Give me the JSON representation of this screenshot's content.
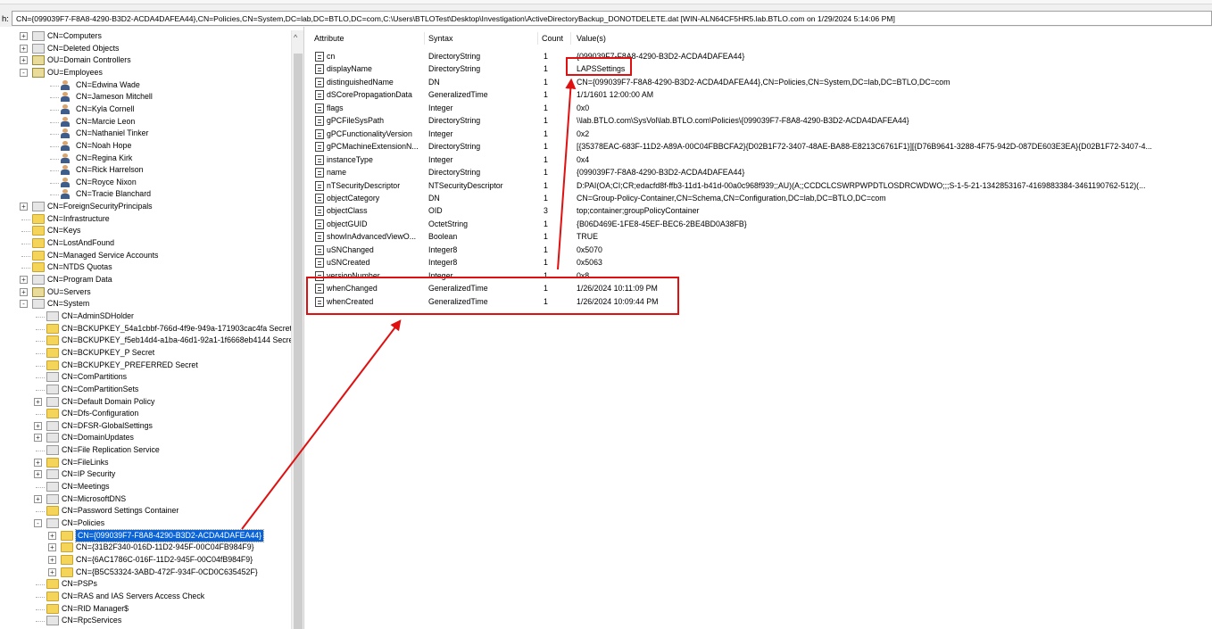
{
  "pathbar": {
    "label": "h:",
    "value": "CN={099039F7-F8A8-4290-B3D2-ACDA4DAFEA44},CN=Policies,CN=System,DC=lab,DC=BTLO,DC=com,C:\\Users\\BTLOTest\\Desktop\\Investigation\\ActiveDirectoryBackup_DONOTDELETE.dat [WIN-ALN64CF5HR5.lab.BTLO.com on 1/29/2024 5:14:06 PM]"
  },
  "tree": {
    "items": [
      {
        "label": "CN=Computers",
        "icon": "container-icon",
        "expander": "+"
      },
      {
        "label": "CN=Deleted Objects",
        "icon": "container-icon",
        "expander": "+"
      },
      {
        "label": "OU=Domain Controllers",
        "icon": "ou-icon",
        "expander": "+"
      },
      {
        "label": "OU=Employees",
        "icon": "ou-icon",
        "expander": "-"
      },
      {
        "label": "CN=Edwina Wade",
        "icon": "user-icon"
      },
      {
        "label": "CN=Jameson Mitchell",
        "icon": "user-icon"
      },
      {
        "label": "CN=Kyla Cornell",
        "icon": "user-icon"
      },
      {
        "label": "CN=Marcie Leon",
        "icon": "user-icon"
      },
      {
        "label": "CN=Nathaniel Tinker",
        "icon": "user-icon"
      },
      {
        "label": "CN=Noah Hope",
        "icon": "user-icon"
      },
      {
        "label": "CN=Regina Kirk",
        "icon": "user-icon"
      },
      {
        "label": "CN=Rick Harrelson",
        "icon": "user-icon"
      },
      {
        "label": "CN=Royce Nixon",
        "icon": "user-icon"
      },
      {
        "label": "CN=Tracie Blanchard",
        "icon": "user-icon"
      },
      {
        "label": "CN=ForeignSecurityPrincipals",
        "icon": "container-icon",
        "expander": "+"
      },
      {
        "label": "CN=Infrastructure",
        "icon": "folder-icon"
      },
      {
        "label": "CN=Keys",
        "icon": "folder-icon"
      },
      {
        "label": "CN=LostAndFound",
        "icon": "folder-icon"
      },
      {
        "label": "CN=Managed Service Accounts",
        "icon": "folder-icon"
      },
      {
        "label": "CN=NTDS Quotas",
        "icon": "folder-icon"
      },
      {
        "label": "CN=Program Data",
        "icon": "container-icon",
        "expander": "+"
      },
      {
        "label": "OU=Servers",
        "icon": "ou-icon",
        "expander": "+"
      },
      {
        "label": "CN=System",
        "icon": "container-icon",
        "expander": "-"
      },
      {
        "label": "CN=AdminSDHolder",
        "icon": "container-icon"
      },
      {
        "label": "CN=BCKUPKEY_54a1cbbf-766d-4f9e-949a-171903cac4fa Secret",
        "icon": "folder-icon"
      },
      {
        "label": "CN=BCKUPKEY_f5eb14d4-a1ba-46d1-92a1-1f6668eb4144 Secret",
        "icon": "folder-icon"
      },
      {
        "label": "CN=BCKUPKEY_P Secret",
        "icon": "folder-icon"
      },
      {
        "label": "CN=BCKUPKEY_PREFERRED Secret",
        "icon": "folder-icon"
      },
      {
        "label": "CN=ComPartitions",
        "icon": "container-icon"
      },
      {
        "label": "CN=ComPartitionSets",
        "icon": "container-icon"
      },
      {
        "label": "CN=Default Domain Policy",
        "icon": "container-icon",
        "expander": "+"
      },
      {
        "label": "CN=Dfs-Configuration",
        "icon": "folder-icon"
      },
      {
        "label": "CN=DFSR-GlobalSettings",
        "icon": "container-icon",
        "expander": "+"
      },
      {
        "label": "CN=DomainUpdates",
        "icon": "container-icon",
        "expander": "+"
      },
      {
        "label": "CN=File Replication Service",
        "icon": "container-icon"
      },
      {
        "label": "CN=FileLinks",
        "icon": "folder-icon",
        "expander": "+"
      },
      {
        "label": "CN=IP Security",
        "icon": "container-icon",
        "expander": "+"
      },
      {
        "label": "CN=Meetings",
        "icon": "container-icon"
      },
      {
        "label": "CN=MicrosoftDNS",
        "icon": "container-icon",
        "expander": "+"
      },
      {
        "label": "CN=Password Settings Container",
        "icon": "folder-icon"
      },
      {
        "label": "CN=Policies",
        "icon": "container-icon",
        "expander": "-"
      },
      {
        "label": "CN={099039F7-F8A8-4290-B3D2-ACDA4DAFEA44}",
        "icon": "folder-icon",
        "expander": "+",
        "selected": true
      },
      {
        "label": "CN={31B2F340-016D-11D2-945F-00C04FB984F9}",
        "icon": "folder-icon",
        "expander": "+"
      },
      {
        "label": "CN={6AC1786C-016F-11D2-945F-00C04fB984F9}",
        "icon": "folder-icon",
        "expander": "+"
      },
      {
        "label": "CN={B5C53324-3ABD-472F-934F-0CD0C635452F}",
        "icon": "folder-icon",
        "expander": "+"
      },
      {
        "label": "CN=PSPs",
        "icon": "folder-icon"
      },
      {
        "label": "CN=RAS and IAS Servers Access Check",
        "icon": "folder-icon"
      },
      {
        "label": "CN=RID Manager$",
        "icon": "folder-icon"
      },
      {
        "label": "CN=RpcServices",
        "icon": "container-icon"
      }
    ]
  },
  "attributes": {
    "columns": {
      "attribute": "Attribute",
      "syntax": "Syntax",
      "count": "Count",
      "values": "Value(s)"
    },
    "rows": [
      {
        "attribute": "cn",
        "syntax": "DirectoryString",
        "count": "1",
        "value": "{099039F7-F8A8-4290-B3D2-ACDA4DAFEA44}"
      },
      {
        "attribute": "displayName",
        "syntax": "DirectoryString",
        "count": "1",
        "value": "LAPSSettings"
      },
      {
        "attribute": "distinguishedName",
        "syntax": "DN",
        "count": "1",
        "value": "CN={099039F7-F8A8-4290-B3D2-ACDA4DAFEA44},CN=Policies,CN=System,DC=lab,DC=BTLO,DC=com"
      },
      {
        "attribute": "dSCorePropagationData",
        "syntax": "GeneralizedTime",
        "count": "1",
        "value": "1/1/1601 12:00:00 AM"
      },
      {
        "attribute": "flags",
        "syntax": "Integer",
        "count": "1",
        "value": "0x0"
      },
      {
        "attribute": "gPCFileSysPath",
        "syntax": "DirectoryString",
        "count": "1",
        "value": "\\\\lab.BTLO.com\\SysVol\\lab.BTLO.com\\Policies\\{099039F7-F8A8-4290-B3D2-ACDA4DAFEA44}"
      },
      {
        "attribute": "gPCFunctionalityVersion",
        "syntax": "Integer",
        "count": "1",
        "value": "0x2"
      },
      {
        "attribute": "gPCMachineExtensionN...",
        "syntax": "DirectoryString",
        "count": "1",
        "value": "[{35378EAC-683F-11D2-A89A-00C04FBBCFA2}{D02B1F72-3407-48AE-BA88-E8213C6761F1}][{D76B9641-3288-4F75-942D-087DE603E3EA}{D02B1F72-3407-4..."
      },
      {
        "attribute": "instanceType",
        "syntax": "Integer",
        "count": "1",
        "value": "0x4"
      },
      {
        "attribute": "name",
        "syntax": "DirectoryString",
        "count": "1",
        "value": "{099039F7-F8A8-4290-B3D2-ACDA4DAFEA44}"
      },
      {
        "attribute": "nTSecurityDescriptor",
        "syntax": "NTSecurityDescriptor",
        "count": "1",
        "value": "D:PAI(OA;CI;CR;edacfd8f-ffb3-11d1-b41d-00a0c968f939;;AU)(A;;CCDCLCSWRPWPDTLOSDRCWDWO;;;S-1-5-21-1342853167-4169883384-3461190762-512)(..."
      },
      {
        "attribute": "objectCategory",
        "syntax": "DN",
        "count": "1",
        "value": "CN=Group-Policy-Container,CN=Schema,CN=Configuration,DC=lab,DC=BTLO,DC=com"
      },
      {
        "attribute": "objectClass",
        "syntax": "OID",
        "count": "3",
        "value": "top;container;groupPolicyContainer"
      },
      {
        "attribute": "objectGUID",
        "syntax": "OctetString",
        "count": "1",
        "value": "{B06D469E-1FE8-45EF-BEC6-2BE4BD0A38FB}"
      },
      {
        "attribute": "showInAdvancedViewO...",
        "syntax": "Boolean",
        "count": "1",
        "value": "TRUE"
      },
      {
        "attribute": "uSNChanged",
        "syntax": "Integer8",
        "count": "1",
        "value": "0x5070"
      },
      {
        "attribute": "uSNCreated",
        "syntax": "Integer8",
        "count": "1",
        "value": "0x5063"
      },
      {
        "attribute": "versionNumber",
        "syntax": "Integer",
        "count": "1",
        "value": "0x8"
      },
      {
        "attribute": "whenChanged",
        "syntax": "GeneralizedTime",
        "count": "1",
        "value": "1/26/2024 10:11:09 PM"
      },
      {
        "attribute": "whenCreated",
        "syntax": "GeneralizedTime",
        "count": "1",
        "value": "1/26/2024 10:09:44 PM"
      }
    ]
  },
  "colors": {
    "annotation": "#e01010",
    "selection": "#0a64d8"
  }
}
